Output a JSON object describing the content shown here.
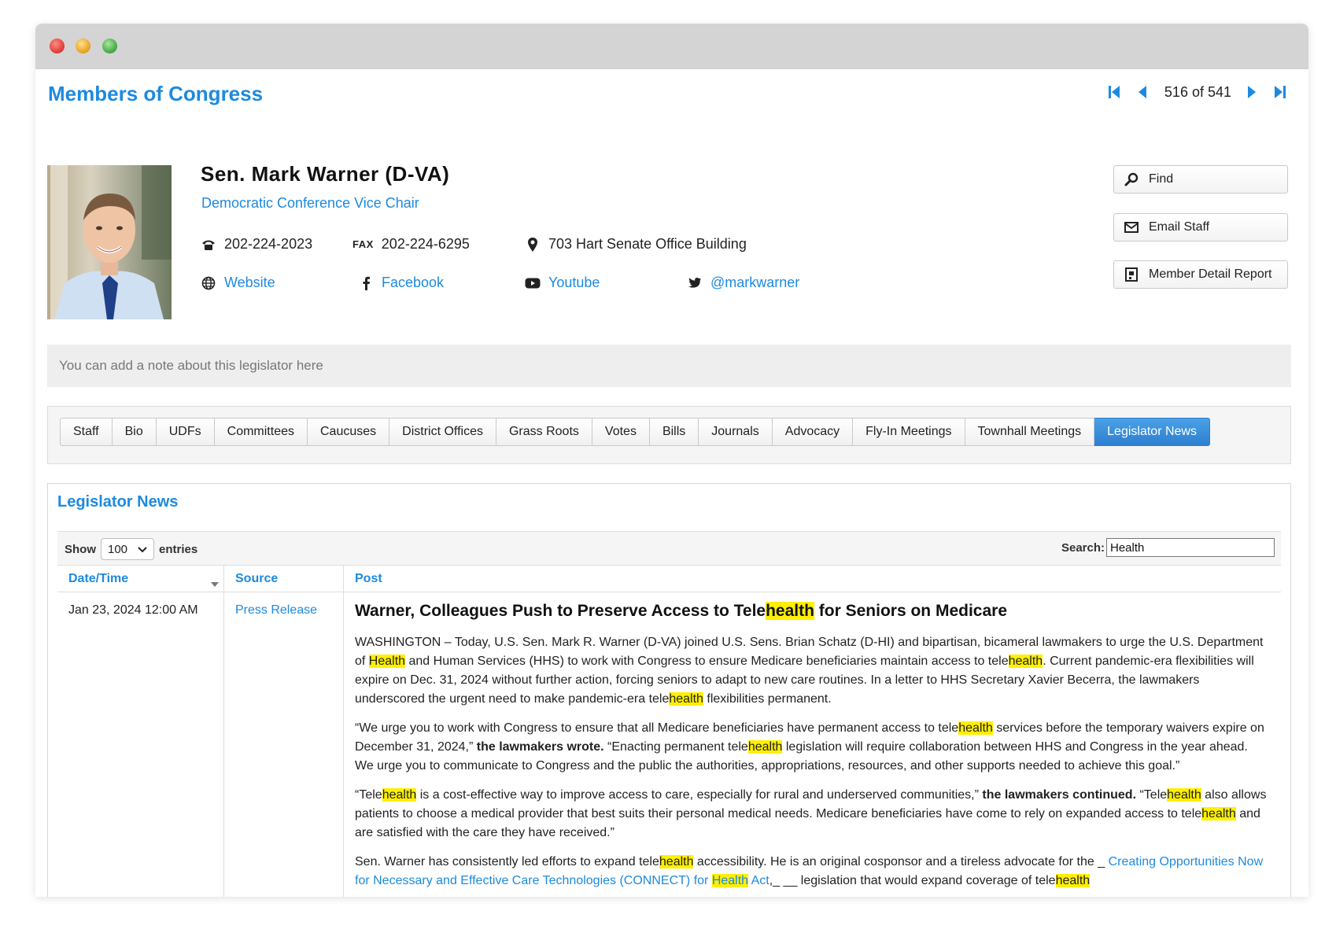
{
  "app": {
    "title": "Members of Congress"
  },
  "pager": {
    "position": "516 of 541"
  },
  "member": {
    "name": "Sen. Mark Warner (D-VA)",
    "role": "Democratic Conference Vice Chair",
    "phone": "202-224-2023",
    "fax_label": "FAX",
    "fax": "202-224-6295",
    "address": "703 Hart Senate Office Building",
    "website": "Website",
    "facebook": "Facebook",
    "youtube": "Youtube",
    "twitter": "@markwarner"
  },
  "actions": {
    "find": "Find",
    "email_staff": "Email Staff",
    "detail_report": "Member Detail Report"
  },
  "note": {
    "placeholder": "You can add a note about this legislator here"
  },
  "tabs": [
    "Staff",
    "Bio",
    "UDFs",
    "Committees",
    "Caucuses",
    "District Offices",
    "Grass Roots",
    "Votes",
    "Bills",
    "Journals",
    "Advocacy",
    "Fly-In Meetings",
    "Townhall Meetings",
    "Legislator News"
  ],
  "active_tab": "Legislator News",
  "panel": {
    "title": "Legislator News",
    "show_label": "Show",
    "show_value": "100",
    "entries_label": "entries",
    "search_label": "Search:",
    "search_value": "Health",
    "columns": [
      "Date/Time",
      "Source",
      "Post"
    ]
  },
  "rows": [
    {
      "date": "Jan 23, 2024 12:00 AM",
      "source": "Press Release",
      "title_parts": [
        "Warner, Colleagues Push to Preserve Access to Tele",
        "health",
        " for Seniors on Medicare"
      ],
      "p1": [
        "WASHINGTON – Today, U.S. Sen. Mark R. Warner (D-VA) joined U.S. Sens. Brian Schatz (D-HI) and bipartisan, bicameral lawmakers to urge the U.S. Department of ",
        "Health",
        " and Human Services (HHS) to work with Congress to ensure Medicare beneficiaries maintain access to tele",
        "health",
        ". Current pandemic-era flexibilities will expire on Dec. 31, 2024 without further action, forcing seniors to adapt to new care routines. In a letter to HHS Secretary Xavier Becerra, the lawmakers underscored the urgent need to make pandemic-era tele",
        "health",
        " flexibilities permanent."
      ],
      "p2": [
        "“We urge you to work with Congress to ensure that all Medicare beneficiaries have permanent access to tele",
        "health",
        " services before the temporary waivers expire on December 31, 2024,”",
        " the lawmakers wrote.",
        " “Enacting permanent tele",
        "health",
        " legislation will require collaboration between HHS and Congress in the year ahead. We urge you to communicate to Congress and the public the authorities, appropriations, resources, and other supports needed to achieve this goal.”"
      ],
      "p3": [
        "“Tele",
        "health",
        " is a cost-effective way to improve access to care, especially for rural and underserved communities,”",
        " the lawmakers continued.",
        " “Tele",
        "health",
        " also allows patients to choose a medical provider that best suits their personal medical needs. Medicare beneficiaries have come to rely on expanded access to tele",
        "health",
        " and are satisfied with the care they have received.”"
      ],
      "p4": [
        "Sen. Warner has consistently led efforts to expand tele",
        "health",
        " accessibility. He is an original cosponsor and a tireless advocate for the  _ ",
        "Creating Opportunities Now for Necessary and Effective Care Technologies (CONNECT) for ",
        "Health",
        " Act",
        ",_ __ legislation that would expand coverage of tele",
        "health"
      ]
    }
  ]
}
